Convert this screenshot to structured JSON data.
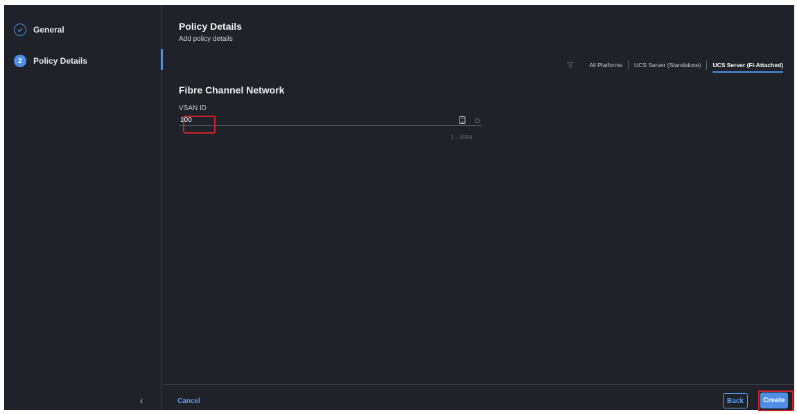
{
  "sidebar": {
    "steps": [
      {
        "label": "General",
        "state": "completed",
        "icon": "check-circle-icon"
      },
      {
        "label": "Policy Details",
        "number": "2",
        "state": "active"
      }
    ],
    "collapse_icon": "chevron-left-icon",
    "collapse_glyph": "‹"
  },
  "main": {
    "title": "Policy Details",
    "subtitle": "Add policy details",
    "platform_filter": {
      "icon": "filter-icon",
      "tabs": [
        {
          "label": "All Platforms",
          "selected": false
        },
        {
          "label": "UCS Server (Standalone)",
          "selected": false
        },
        {
          "label": "UCS Server (FI-Attached)",
          "selected": true
        }
      ]
    },
    "section_title": "Fibre Channel Network",
    "vsan": {
      "label": "VSAN ID",
      "value": "100",
      "range_hint": "1 - 4094"
    }
  },
  "footer": {
    "cancel_label": "Cancel",
    "back_label": "Back",
    "create_label": "Create"
  },
  "colors": {
    "background": "#1f2329",
    "accent": "#4f8ee6",
    "link": "#5a9cf0",
    "highlight": "#c8242b"
  }
}
